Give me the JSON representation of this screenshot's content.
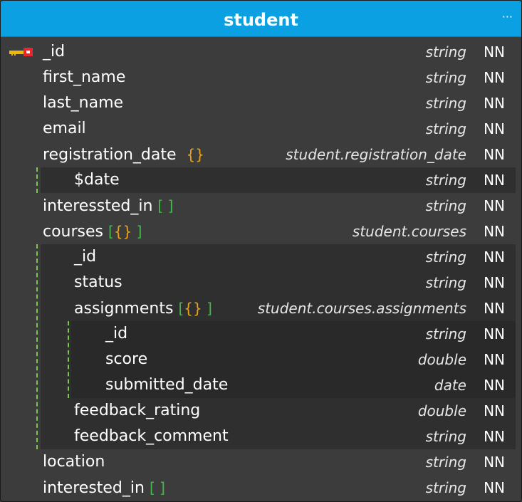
{
  "entity": {
    "title": "student",
    "menu_icon": "ellipsis-icon",
    "colors": {
      "header": "#0ba0e2",
      "background": "#3c3c3c",
      "nested_background": "#2f2f2f",
      "bracket": "#44b84a",
      "brace": "#e8a21c",
      "guide": "#7ac74f"
    },
    "fields": [
      {
        "name": "_id",
        "type": "string",
        "nn": "NN",
        "pk": true
      },
      {
        "name": "first_name",
        "type": "string",
        "nn": "NN"
      },
      {
        "name": "last_name",
        "type": "string",
        "nn": "NN"
      },
      {
        "name": "email",
        "type": "string",
        "nn": "NN"
      },
      {
        "name": "registration_date",
        "type": "student.registration_date",
        "nn": "NN",
        "sym_open": "",
        "sym_mid": "{}",
        "sym_close": ""
      },
      {
        "name": "$date",
        "type": "string",
        "nn": "NN"
      },
      {
        "name": "interessted_in",
        "type": "string",
        "nn": "NN",
        "sym_open": "[",
        "sym_mid": "",
        "sym_close": "]"
      },
      {
        "name": "courses",
        "type": "student.courses",
        "nn": "NN",
        "sym_open": "[",
        "sym_mid": "{}",
        "sym_close": "]"
      },
      {
        "name": "_id",
        "type": "string",
        "nn": "NN"
      },
      {
        "name": "status",
        "type": "string",
        "nn": "NN"
      },
      {
        "name": "assignments",
        "type": "student.courses.assignments",
        "nn": "NN",
        "sym_open": "[",
        "sym_mid": "{}",
        "sym_close": "]"
      },
      {
        "name": "_id",
        "type": "string",
        "nn": "NN"
      },
      {
        "name": "score",
        "type": "double",
        "nn": "NN"
      },
      {
        "name": "submitted_date",
        "type": "date",
        "nn": "NN"
      },
      {
        "name": "feedback_rating",
        "type": "double",
        "nn": "NN"
      },
      {
        "name": "feedback_comment",
        "type": "string",
        "nn": "NN"
      },
      {
        "name": "location",
        "type": "string",
        "nn": "NN"
      },
      {
        "name": "interested_in",
        "type": "string",
        "nn": "NN",
        "sym_open": "[",
        "sym_mid": "",
        "sym_close": "]"
      }
    ]
  }
}
